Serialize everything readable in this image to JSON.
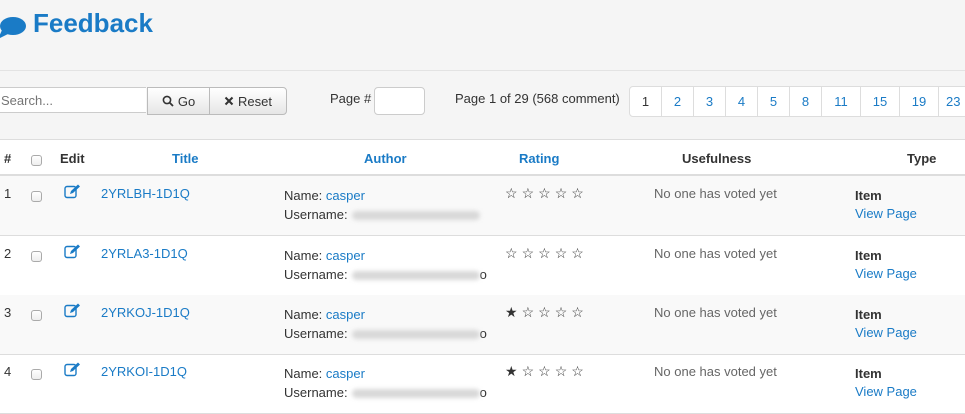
{
  "header": {
    "title": "Feedback",
    "icon": "chat-bubble-icon"
  },
  "toolbar": {
    "search_placeholder": "Search...",
    "go_label": "Go",
    "reset_label": "Reset",
    "page_label": "Page #",
    "page_info": "Page 1 of 29 (568 comment)",
    "pages": [
      "1",
      "2",
      "3",
      "4",
      "5",
      "8",
      "11",
      "15",
      "19",
      "23"
    ]
  },
  "columns": {
    "num": "#",
    "edit": "Edit",
    "title": "Title",
    "author": "Author",
    "rating": "Rating",
    "usefulness": "Usefulness",
    "type": "Type"
  },
  "rows": [
    {
      "num": "1",
      "title": "2YRLBH-1D1Q",
      "name_label": "Name:",
      "name": "casper",
      "username_label": "Username:",
      "username_visible": "",
      "stars_filled": 0,
      "usefulness": "No one has voted yet",
      "type": "Item",
      "view": "View Page"
    },
    {
      "num": "2",
      "title": "2YRLA3-1D1Q",
      "name_label": "Name:",
      "name": "casper",
      "username_label": "Username:",
      "username_visible": "o",
      "stars_filled": 0,
      "usefulness": "No one has voted yet",
      "type": "Item",
      "view": "View Page"
    },
    {
      "num": "3",
      "title": "2YRKOJ-1D1Q",
      "name_label": "Name:",
      "name": "casper",
      "username_label": "Username:",
      "username_visible": "o",
      "stars_filled": 1,
      "usefulness": "No one has voted yet",
      "type": "Item",
      "view": "View Page"
    },
    {
      "num": "4",
      "title": "2YRKOI-1D1Q",
      "name_label": "Name:",
      "name": "casper",
      "username_label": "Username:",
      "username_visible": "o",
      "stars_filled": 1,
      "usefulness": "No one has voted yet",
      "type": "Item",
      "view": "View Page"
    }
  ],
  "colors": {
    "accent": "#1a7bc6",
    "header_bg": "#f5f5f5"
  }
}
